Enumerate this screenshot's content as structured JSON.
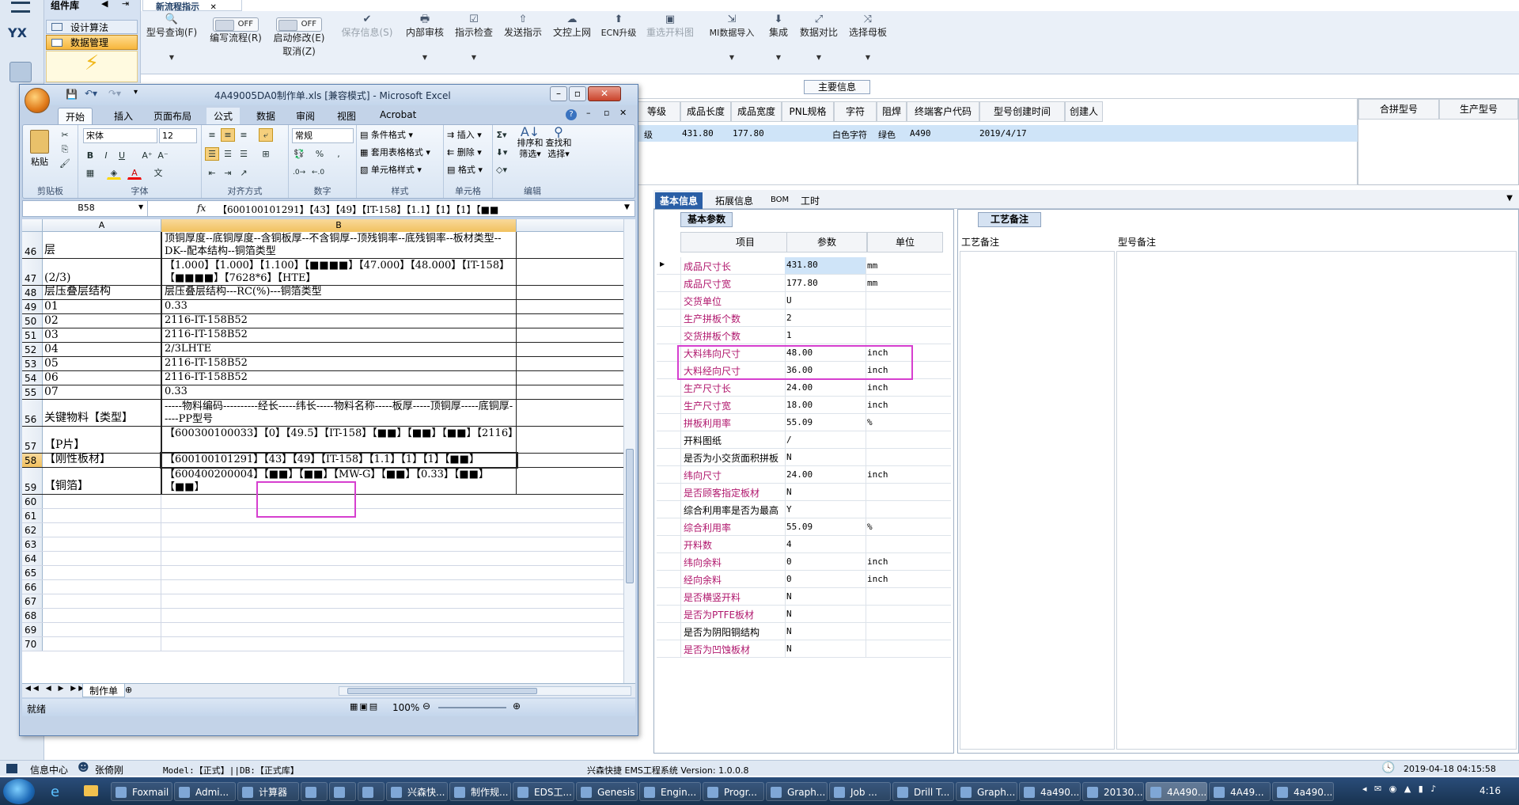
{
  "host": {
    "component_library": "组件库",
    "nav_items": [
      "设计算法",
      "数据管理"
    ],
    "logo_text": "YX",
    "main_tab": "新流程指示",
    "ribbon": [
      {
        "label": "型号查询(F)",
        "icon": "search-icon",
        "dropdown": true,
        "disabled": false
      },
      {
        "label": "编写流程(R)",
        "icon": "toggle-off-icon",
        "toggle": "OFF",
        "disabled": false
      },
      {
        "label": "启动修改(E)",
        "sub": "取消(Z)",
        "icon": "toggle-off-icon",
        "toggle": "OFF",
        "disabled": false
      },
      {
        "label": "保存信息(S)",
        "icon": "check-icon",
        "disabled": true
      },
      {
        "label": "内部审核",
        "icon": "printer-icon",
        "dropdown": true,
        "disabled": false
      },
      {
        "label": "指示检查",
        "icon": "checklist-icon",
        "dropdown": true,
        "disabled": false
      },
      {
        "label": "发送指示",
        "icon": "upload-icon",
        "disabled": false
      },
      {
        "label": "文控上网",
        "icon": "cloud-upload-icon",
        "disabled": false
      },
      {
        "label": "ECN升级",
        "icon": "ecn-icon",
        "disabled": false
      },
      {
        "label": "重选开料图",
        "icon": "image-icon",
        "disabled": true
      },
      {
        "label": "MI数据导入",
        "icon": "import-icon",
        "dropdown": true,
        "disabled": false
      },
      {
        "label": "集成",
        "icon": "download-icon",
        "dropdown": true,
        "disabled": false
      },
      {
        "label": "数据对比",
        "icon": "compare-icon",
        "dropdown": true,
        "disabled": false
      },
      {
        "label": "选择母板",
        "icon": "shuffle-icon",
        "dropdown": true,
        "disabled": false
      }
    ],
    "main_info_label": "主要信息",
    "grid_headers": [
      "等级",
      "成品长度",
      "成品宽度",
      "PNL规格",
      "字符",
      "阻焊",
      "终端客户代码",
      "型号创建时间",
      "创建人"
    ],
    "grid_row": [
      "级",
      "431.80",
      "177.80",
      "",
      "白色字符",
      "绿色",
      "A490",
      "2019/4/17",
      ""
    ],
    "merge_headers": [
      "合拼型号",
      "生产型号"
    ],
    "sub_tabs": [
      "基本信息",
      "拓展信息",
      "BOM",
      "工时"
    ],
    "basic_params": {
      "title": "基本参数",
      "headers": [
        "项目",
        "参数",
        "单位"
      ],
      "rows": [
        {
          "item": "成品尺寸长",
          "value": "431.80",
          "unit": "mm",
          "pink": true
        },
        {
          "item": "成品尺寸宽",
          "value": "177.80",
          "unit": "mm",
          "pink": true
        },
        {
          "item": "交货单位",
          "value": "U",
          "unit": "",
          "pink": true
        },
        {
          "item": "生产拼板个数",
          "value": "2",
          "unit": "",
          "pink": true
        },
        {
          "item": "交货拼板个数",
          "value": "1",
          "unit": "",
          "pink": true
        },
        {
          "item": "大料纬向尺寸",
          "value": "48.00",
          "unit": "inch",
          "pink": true
        },
        {
          "item": "大料经向尺寸",
          "value": "36.00",
          "unit": "inch",
          "pink": true
        },
        {
          "item": "生产尺寸长",
          "value": "24.00",
          "unit": "inch",
          "pink": true
        },
        {
          "item": "生产尺寸宽",
          "value": "18.00",
          "unit": "inch",
          "pink": true
        },
        {
          "item": "拼板利用率",
          "value": "55.09",
          "unit": "%",
          "pink": true
        },
        {
          "item": "开料图纸",
          "value": "/",
          "unit": "",
          "pink": false
        },
        {
          "item": "是否为小交货面积拼板",
          "value": "N",
          "unit": "",
          "pink": false
        },
        {
          "item": "纬向尺寸",
          "value": "24.00",
          "unit": "inch",
          "pink": true
        },
        {
          "item": "是否顾客指定板材",
          "value": "N",
          "unit": "",
          "pink": true
        },
        {
          "item": "综合利用率是否为最高",
          "value": "Y",
          "unit": "",
          "pink": false
        },
        {
          "item": "综合利用率",
          "value": "55.09",
          "unit": "%",
          "pink": true
        },
        {
          "item": "开料数",
          "value": "4",
          "unit": "",
          "pink": true
        },
        {
          "item": "纬向余料",
          "value": "0",
          "unit": "inch",
          "pink": true
        },
        {
          "item": "经向余料",
          "value": "0",
          "unit": "inch",
          "pink": true
        },
        {
          "item": "是否横竖开料",
          "value": "N",
          "unit": "",
          "pink": true
        },
        {
          "item": "是否为PTFE板材",
          "value": "N",
          "unit": "",
          "pink": true
        },
        {
          "item": "是否为阴阳铜结构",
          "value": "N",
          "unit": "",
          "pink": false
        },
        {
          "item": "是否为凹蚀板材",
          "value": "N",
          "unit": "",
          "pink": true
        }
      ]
    },
    "remark": {
      "tab": "工艺备注",
      "col1": "工艺备注",
      "col2": "型号备注"
    },
    "status": {
      "info_center": "信息中心",
      "user": "张倚刚",
      "model": "Model:【正式】||DB:【正式库】",
      "system": "兴森快捷 EMS工程系统 Version: 1.0.0.8",
      "datetime": "2019-04-18 04:15:58"
    }
  },
  "excel": {
    "title": "4A49005DA0制作单.xls  [兼容模式] - Microsoft Excel",
    "tabs": [
      "开始",
      "插入",
      "页面布局",
      "公式",
      "数据",
      "审阅",
      "视图",
      "Acrobat"
    ],
    "active_tab": "开始",
    "groups": [
      "剪贴板",
      "字体",
      "对齐方式",
      "数字",
      "样式",
      "单元格",
      "编辑"
    ],
    "paste": "粘贴",
    "font_name": "宋体",
    "font_size": "12",
    "number_format": "常规",
    "styles": [
      "条件格式",
      "套用表格格式",
      "单元格样式"
    ],
    "cells_cmds": [
      "插入",
      "删除",
      "格式"
    ],
    "edit_cmds": [
      "排序和\n筛选",
      "查找和\n选择"
    ],
    "sort_label": "排序和",
    "sort_label2": "筛选",
    "find_label": "查找和",
    "find_label2": "选择",
    "name_box": "B58",
    "formula": "【600100101291】【43】【49】【IT-158】【1.1】【1】【1】【■■",
    "columns": [
      "A",
      "B"
    ],
    "rows": [
      {
        "n": "46",
        "a": "层",
        "b": "顶铜厚度--底铜厚度--含铜板厚--不含铜厚--顶残铜率--底残铜率--板材类型--DK--配本结构--铜箔类型",
        "h": 32,
        "bordered": true
      },
      {
        "n": "47",
        "a": "(2/3)",
        "b": "【1.000】【1.000】【1.100】【■■■■】【47.000】【48.000】【IT-158】【■■■■】【7628*6】【HTE】",
        "h": 32,
        "bordered": true
      },
      {
        "n": "48",
        "a": "层压叠层结构",
        "b": "层压叠层结构---RC(%)---铜箔类型",
        "h": 16,
        "bordered": true
      },
      {
        "n": "49",
        "a": "01",
        "b": "0.33",
        "h": 16,
        "bordered": true
      },
      {
        "n": "50",
        "a": "02",
        "b": "2116-IT-158B52",
        "h": 16,
        "bordered": true
      },
      {
        "n": "51",
        "a": "03",
        "b": "2116-IT-158B52",
        "h": 16,
        "bordered": true
      },
      {
        "n": "52",
        "a": "04",
        "b": "2/3LHTE",
        "h": 16,
        "bordered": true
      },
      {
        "n": "53",
        "a": "05",
        "b": "2116-IT-158B52",
        "h": 16,
        "bordered": true
      },
      {
        "n": "54",
        "a": "06",
        "b": "2116-IT-158B52",
        "h": 16,
        "bordered": true
      },
      {
        "n": "55",
        "a": "07",
        "b": "0.33",
        "h": 16,
        "bordered": true
      },
      {
        "n": "56",
        "a": "关键物料【类型】",
        "b": "-----物料编码----------经长-----纬长-----物料名称-----板厚-----顶铜厚-----底铜厚-----PP型号",
        "h": 32,
        "bordered": true
      },
      {
        "n": "57",
        "a": "【P片】",
        "b": "【600300100033】【0】【49.5】【IT-158】【■■】【■■】【■■】【2116】",
        "h": 32,
        "bordered": true
      },
      {
        "n": "58",
        "a": "【刚性板材】",
        "b": "【600100101291】【43】【49】【IT-158】【1.1】【1】【1】【■■】",
        "h": 16,
        "bordered": true,
        "selected": true
      },
      {
        "n": "59",
        "a": "【铜箔】",
        "b": "【600400200004】【■■】【■■】【MW-G】【■■】【0.33】【■■】【■■】",
        "h": 32,
        "bordered": true
      },
      {
        "n": "60",
        "a": "",
        "b": "",
        "h": 16
      },
      {
        "n": "61",
        "a": "",
        "b": "",
        "h": 16
      },
      {
        "n": "62",
        "a": "",
        "b": "",
        "h": 16
      },
      {
        "n": "63",
        "a": "",
        "b": "",
        "h": 16
      },
      {
        "n": "64",
        "a": "",
        "b": "",
        "h": 16
      },
      {
        "n": "65",
        "a": "",
        "b": "",
        "h": 16
      },
      {
        "n": "66",
        "a": "",
        "b": "",
        "h": 16
      },
      {
        "n": "67",
        "a": "",
        "b": "",
        "h": 16
      },
      {
        "n": "68",
        "a": "",
        "b": "",
        "h": 16
      },
      {
        "n": "69",
        "a": "",
        "b": "",
        "h": 16
      },
      {
        "n": "70",
        "a": "",
        "b": "",
        "h": 16
      }
    ],
    "sheet_tab": "制作单",
    "status_ready": "就绪",
    "zoom": "100%"
  },
  "taskbar": [
    {
      "label": "Foxmail"
    },
    {
      "label": "Admi..."
    },
    {
      "label": "计算器"
    },
    {
      "label": ""
    },
    {
      "label": ""
    },
    {
      "label": ""
    },
    {
      "label": "兴森快..."
    },
    {
      "label": "制作规..."
    },
    {
      "label": "EDS工..."
    },
    {
      "label": "Genesis"
    },
    {
      "label": "Engin..."
    },
    {
      "label": "Progr..."
    },
    {
      "label": "Graph..."
    },
    {
      "label": "Job ..."
    },
    {
      "label": "Drill T..."
    },
    {
      "label": "Graph..."
    },
    {
      "label": "4a490..."
    },
    {
      "label": "20130..."
    },
    {
      "label": "4A490...",
      "active": true
    },
    {
      "label": "4A49..."
    },
    {
      "label": "4a490..."
    }
  ],
  "clock": "4:16",
  "colors": {
    "accent": "#2a5fa6",
    "highlight": "#d63fcf",
    "pink_text": "#b0176d"
  }
}
